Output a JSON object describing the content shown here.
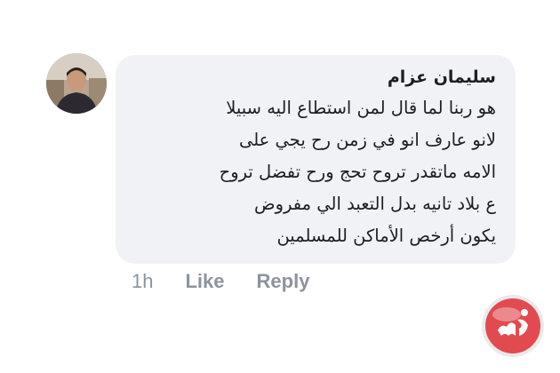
{
  "comment": {
    "author": "سليمان عزام",
    "lines": [
      "هو ربنا لما قال لمن استطاع اليه سبيلا",
      "لانو عارف انو في زمن رح يجي على",
      "الامه ماتقدر تروح تحج ورح تفضل تروح",
      "ع بلاد تانيه بدل التعبد الي مفروض",
      "يكون أرخص الأماكن للمسلمين"
    ]
  },
  "actions": {
    "time": "1h",
    "like_label": "Like",
    "reply_label": "Reply"
  },
  "icons": {
    "avatar": "user-photo",
    "watermark": "maan-logo"
  },
  "colors": {
    "bubble_bg": "#f0f2f5",
    "action_text": "#8d949e",
    "text": "#1c1e21",
    "watermark_red": "#e03a3e"
  }
}
